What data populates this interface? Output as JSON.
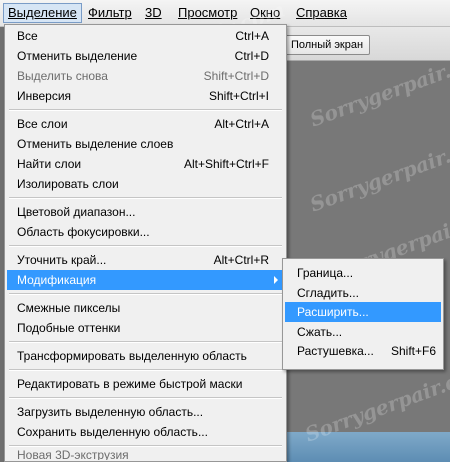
{
  "menubar": {
    "items": [
      "Выделение",
      "Фильтр",
      "3D",
      "Просмотр",
      "Окно",
      "Справка"
    ]
  },
  "options_bar": {
    "fullscreen_label": "Полный экран"
  },
  "watermark": "Sorrygerpair.com",
  "menu": {
    "items": [
      {
        "label": "Все",
        "shortcut": "Ctrl+A"
      },
      {
        "label": "Отменить выделение",
        "shortcut": "Ctrl+D"
      },
      {
        "label": "Выделить снова",
        "shortcut": "Shift+Ctrl+D"
      },
      {
        "label": "Инверсия",
        "shortcut": "Shift+Ctrl+I"
      },
      {
        "label": "Все слои",
        "shortcut": "Alt+Ctrl+A"
      },
      {
        "label": "Отменить выделение слоев",
        "shortcut": ""
      },
      {
        "label": "Найти слои",
        "shortcut": "Alt+Shift+Ctrl+F"
      },
      {
        "label": "Изолировать слои",
        "shortcut": ""
      },
      {
        "label": "Цветовой диапазон...",
        "shortcut": ""
      },
      {
        "label": "Область фокусировки...",
        "shortcut": ""
      },
      {
        "label": "Уточнить край...",
        "shortcut": "Alt+Ctrl+R"
      },
      {
        "label": "Модификация",
        "shortcut": ""
      },
      {
        "label": "Смежные пикселы",
        "shortcut": ""
      },
      {
        "label": "Подобные оттенки",
        "shortcut": ""
      },
      {
        "label": "Трансформировать выделенную область",
        "shortcut": ""
      },
      {
        "label": "Редактировать в режиме быстрой маски",
        "shortcut": ""
      },
      {
        "label": "Загрузить выделенную область...",
        "shortcut": ""
      },
      {
        "label": "Сохранить выделенную область...",
        "shortcut": ""
      },
      {
        "label": "Новая 3D-экструзия",
        "shortcut": ""
      }
    ]
  },
  "submenu": {
    "items": [
      {
        "label": "Граница...",
        "shortcut": ""
      },
      {
        "label": "Сгладить...",
        "shortcut": ""
      },
      {
        "label": "Расширить...",
        "shortcut": ""
      },
      {
        "label": "Сжать...",
        "shortcut": ""
      },
      {
        "label": "Растушевка...",
        "shortcut": "Shift+F6"
      }
    ]
  },
  "colors": {
    "highlight": "#3399ff",
    "menu_bg": "#f0f0f0",
    "disabled_text": "#6d6d6d"
  }
}
